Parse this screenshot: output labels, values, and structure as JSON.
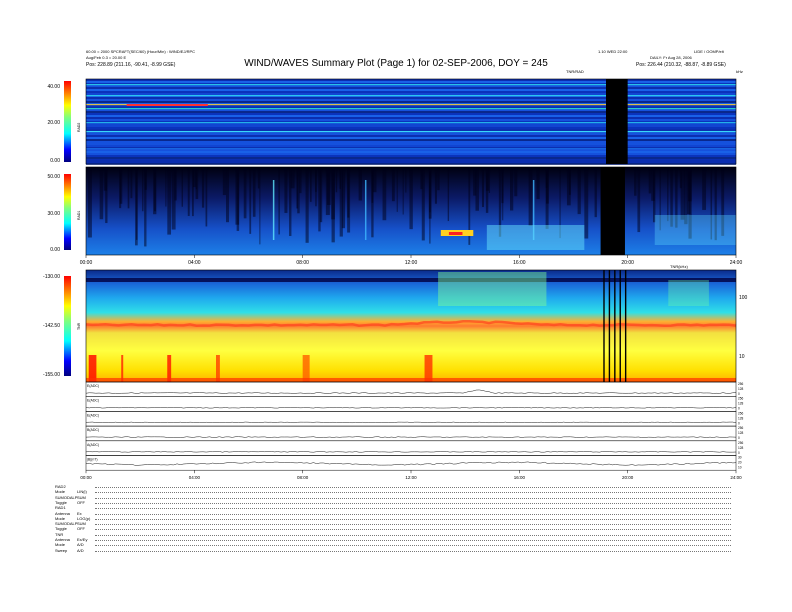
{
  "header": {
    "title": "WIND/WAVES Summary Plot (Page 1) for 02-SEP-2006, DOY = 245",
    "left_line1": "60.00 = 2000 SPCRAFT(SEC/60) (Hour/Min) : WIND/EJ/RPC",
    "left_line2": "Aug/Feb 0.3 = 20.00 E",
    "left_line3": "Pos:  228.89 (211.16, -90.41, -8.99 GSE)",
    "right_line1": "1.10 WED 22:00",
    "right_line2": "LIDE / OOMP/elt",
    "right_line3": "DAILY: Fr Aug 28, 2006",
    "right_line4": "Pos:  226.44 (210.32, -88.87, -8.89 GSE)",
    "right_unit": "kHz",
    "tnr_unit_label": "TNR(kHz)",
    "rad2_tag": "TNR/RAD"
  },
  "chart_data": [
    {
      "type": "heatmap",
      "name_label": "RAD2",
      "y_ticks": [
        "40.00",
        "20.00",
        "0.00"
      ],
      "ylim": [
        0,
        40
      ],
      "x_range_hours": [
        0,
        24
      ],
      "gap_hours": [
        19.2,
        20.0
      ]
    },
    {
      "type": "heatmap",
      "name_label": "RAD1",
      "y_ticks": [
        "50.00",
        "30.00",
        "0.00"
      ],
      "ylim": [
        0,
        50
      ],
      "x_range_hours": [
        0,
        24
      ],
      "x_ticks": [
        "00:00",
        "04:00",
        "08:00",
        "12:00",
        "16:00",
        "20:00",
        "24:00"
      ],
      "gap_hours": [
        19.0,
        19.9
      ]
    },
    {
      "type": "heatmap",
      "name_label": "TNR",
      "y_ticks": [
        "-130.00",
        "-142.50",
        "-155.00"
      ],
      "right_ticks": [
        "100",
        "10"
      ],
      "ylim": [
        -155,
        -130
      ],
      "x_range_hours": [
        0,
        24
      ],
      "gap_lines_hours": [
        19.1,
        19.3,
        19.5,
        19.7,
        19.9
      ]
    },
    {
      "type": "line",
      "panels": [
        {
          "label": "E(ADC)",
          "right_ticks": [
            "256",
            "128",
            "0"
          ]
        },
        {
          "label": "E(ADC)",
          "right_ticks": [
            "256",
            "128",
            "0"
          ]
        },
        {
          "label": "E(ADC)",
          "right_ticks": [
            "256",
            "128",
            "0"
          ]
        },
        {
          "label": "B(ADC)",
          "right_ticks": [
            "256",
            "128",
            "0"
          ]
        },
        {
          "label": "A(ADC)",
          "right_ticks": [
            "256",
            "128",
            "0"
          ]
        },
        {
          "label": "|B|(nT)",
          "right_ticks": [
            "30",
            "20",
            "10"
          ]
        }
      ],
      "x_ticks": [
        "00:00",
        "04:00",
        "08:00",
        "12:00",
        "16:00",
        "20:00",
        "24:00"
      ],
      "x_range_hours": [
        0,
        24
      ]
    }
  ],
  "footer": {
    "rows": [
      {
        "k": "RAD2",
        "v": ""
      },
      {
        "k": "Mode",
        "v": "LIN(l)"
      },
      {
        "k": "SUMODALP",
        "v": "SUM"
      },
      {
        "k": "Toggle",
        "v": "OFF"
      },
      {
        "k": "RAD1",
        "v": ""
      },
      {
        "k": "Antenna",
        "v": "Ex"
      },
      {
        "k": "Mode",
        "v": "LOG(p)"
      },
      {
        "k": "SUMODALP",
        "v": "SUM"
      },
      {
        "k": "Toggle",
        "v": "OFF"
      },
      {
        "k": "TNR",
        "v": ""
      },
      {
        "k": "Antenna",
        "v": "Ex/Ey"
      },
      {
        "k": "Mode",
        "v": "A/D"
      },
      {
        "k": "Sweep",
        "v": "A/D"
      }
    ]
  }
}
